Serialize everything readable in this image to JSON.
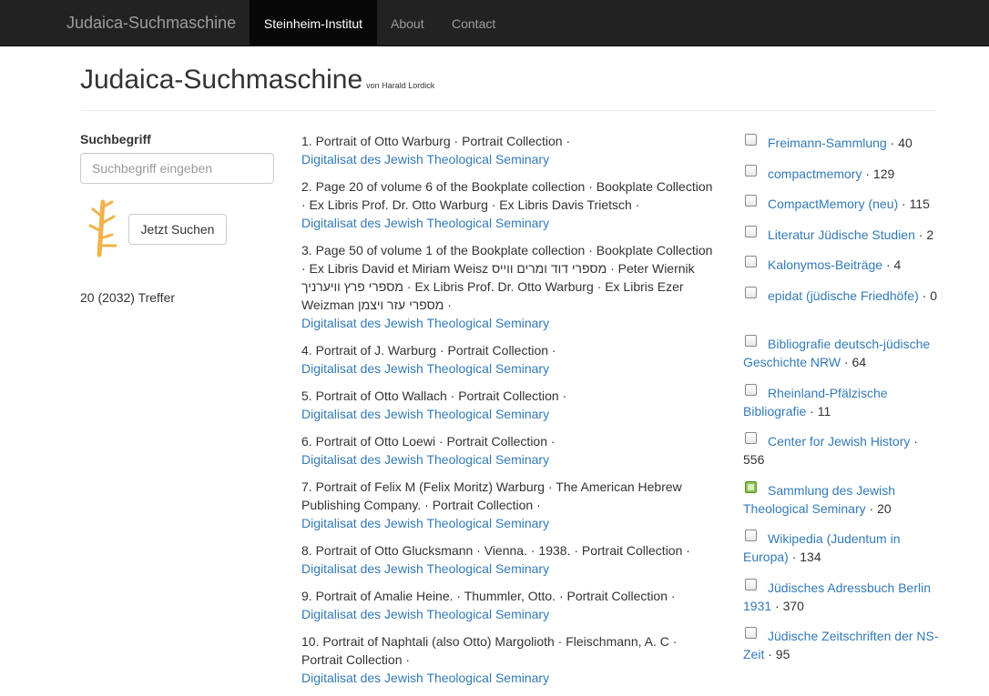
{
  "navbar": {
    "brand": "Judaica-Suchmaschine",
    "items": [
      {
        "label": "Steinheim-Institut"
      },
      {
        "label": "About"
      },
      {
        "label": "Contact"
      }
    ]
  },
  "header": {
    "title": "Judaica-Suchmaschine",
    "byline": "von Harald Lordick"
  },
  "search": {
    "label": "Suchbegriff",
    "placeholder": "Suchbegriff eingeben",
    "button": "Jetzt Suchen",
    "hits": "20 (2032) Treffer"
  },
  "results": [
    {
      "text": "1. Portrait of Otto Warburg · Portrait Collection ·",
      "link": "Digitalisat des Jewish Theological Seminary"
    },
    {
      "text": "2. Page 20 of volume 6 of the Bookplate collection · Bookplate Collection · Ex Libris Prof. Dr. Otto Warburg · Ex Libris Davis Trietsch ·",
      "link": "Digitalisat des Jewish Theological Seminary"
    },
    {
      "text": "3. Page 50 of volume 1 of the Bookplate collection · Bookplate Collection · Ex Libris David et Miriam Weisz מספרי דוד ומרים ווייס · Peter Wiernik מספרי פרץ וויערניך · Ex Libris Prof. Dr. Otto Warburg · Ex Libris Ezer Weizman מספרי עזר ויצמן ·",
      "link": "Digitalisat des Jewish Theological Seminary"
    },
    {
      "text": "4. Portrait of J. Warburg · Portrait Collection ·",
      "link": "Digitalisat des Jewish Theological Seminary"
    },
    {
      "text": "5. Portrait of Otto Wallach · Portrait Collection ·",
      "link": "Digitalisat des Jewish Theological Seminary"
    },
    {
      "text": "6. Portrait of Otto Loewi · Portrait Collection ·",
      "link": "Digitalisat des Jewish Theological Seminary"
    },
    {
      "text": "7. Portrait of Felix M (Felix Moritz) Warburg · The American Hebrew Publishing Company. · Portrait Collection ·",
      "link": "Digitalisat des Jewish Theological Seminary"
    },
    {
      "text": "8. Portrait of Otto Glucksmann · Vienna. · 1938. · Portrait Collection ·",
      "link": "Digitalisat des Jewish Theological Seminary"
    },
    {
      "text": "9. Portrait of Amalie Heine. · Thummler, Otto. · Portrait Collection ·",
      "link": "Digitalisat des Jewish Theological Seminary"
    },
    {
      "text": "10. Portrait of Naphtali (also Otto) Margolioth · Fleischmann, A. C · Portrait Collection ·",
      "link": "Digitalisat des Jewish Theological Seminary"
    }
  ],
  "facets": [
    {
      "label": "Freimann-Sammlung",
      "count": " · 40",
      "checked": false
    },
    {
      "label": "compactmemory",
      "count": " · 129",
      "checked": false
    },
    {
      "label": "CompactMemory (neu)",
      "count": " · 115",
      "checked": false
    },
    {
      "label": "Literatur Jüdische Studien",
      "count": " · 2",
      "checked": false
    },
    {
      "label": "Kalonymos-Beiträge",
      "count": " · 4",
      "checked": false
    },
    {
      "label": "epidat (jüdische Friedhöfe)",
      "count": " · 0",
      "checked": false
    },
    {
      "label": "Bibliografie deutsch-jüdische Geschichte NRW",
      "count": " · 64",
      "checked": false
    },
    {
      "label": "Rheinland-Pfälzische Bibliografie",
      "count": " · 11",
      "checked": false
    },
    {
      "label": "Center for Jewish History",
      "count": " · 556",
      "checked": false
    },
    {
      "label": "Sammlung des Jewish Theological Seminary",
      "count": " · 20",
      "checked": true
    },
    {
      "label": "Wikipedia (Judentum in Europa)",
      "count": " · 134",
      "checked": false
    },
    {
      "label": "Jüdisches Adressbuch Berlin 1931",
      "count": " · 370",
      "checked": false
    },
    {
      "label": "Jüdische Zeitschriften der NS-Zeit",
      "count": " · 95",
      "checked": false
    }
  ]
}
